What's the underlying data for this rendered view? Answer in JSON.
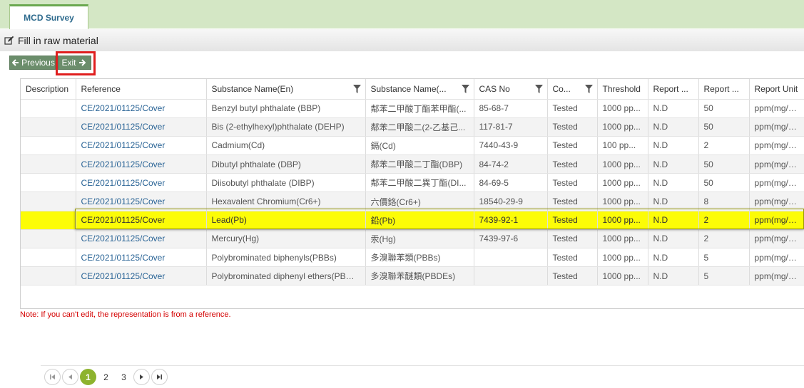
{
  "tabs": [
    {
      "label": "MCD Survey"
    }
  ],
  "section": {
    "title": "Fill in raw material"
  },
  "toolbar": {
    "previous_label": "Previous",
    "exit_label": "Exit"
  },
  "table": {
    "columns": [
      "Description",
      "Reference",
      "Substance Name(En)",
      "Substance Name(...",
      "CAS No",
      "Co...",
      "Threshold",
      "Report ...",
      "Report ...",
      "Report Unit"
    ],
    "rows": [
      [
        "",
        "CE/2021/01125/Cover",
        "Benzyl butyl phthalate (BBP)",
        "鄰苯二甲酸丁酯苯甲酯(...",
        "85-68-7",
        "Tested",
        "1000 pp...",
        "N.D",
        "50",
        "ppm(mg/kg)"
      ],
      [
        "",
        "CE/2021/01125/Cover",
        "Bis (2-ethylhexyl)phthalate (DEHP)",
        "鄰苯二甲酸二(2-乙基己...",
        "117-81-7",
        "Tested",
        "1000 pp...",
        "N.D",
        "50",
        "ppm(mg/kg)"
      ],
      [
        "",
        "CE/2021/01125/Cover",
        "Cadmium(Cd)",
        "鎘(Cd)",
        "7440-43-9",
        "Tested",
        "100 pp...",
        "N.D",
        "2",
        "ppm(mg/kg)"
      ],
      [
        "",
        "CE/2021/01125/Cover",
        "Dibutyl phthalate (DBP)",
        "鄰苯二甲酸二丁酯(DBP)",
        "84-74-2",
        "Tested",
        "1000 pp...",
        "N.D",
        "50",
        "ppm(mg/kg)"
      ],
      [
        "",
        "CE/2021/01125/Cover",
        "Diisobutyl phthalate (DIBP)",
        "鄰苯二甲酸二異丁酯(DI...",
        "84-69-5",
        "Tested",
        "1000 pp...",
        "N.D",
        "50",
        "ppm(mg/kg)"
      ],
      [
        "",
        "CE/2021/01125/Cover",
        "Hexavalent Chromium(Cr6+)",
        "六價鉻(Cr6+)",
        "18540-29-9",
        "Tested",
        "1000 pp...",
        "N.D",
        "8",
        "ppm(mg/kg)"
      ],
      [
        "",
        "CE/2021/01125/Cover",
        "Lead(Pb)",
        "鉛(Pb)",
        "7439-92-1",
        "Tested",
        "1000 pp...",
        "N.D",
        "2",
        "ppm(mg/kg)"
      ],
      [
        "",
        "CE/2021/01125/Cover",
        "Mercury(Hg)",
        "汞(Hg)",
        "7439-97-6",
        "Tested",
        "1000 pp...",
        "N.D",
        "2",
        "ppm(mg/kg)"
      ],
      [
        "",
        "CE/2021/01125/Cover",
        "Polybrominated biphenyls(PBBs)",
        "多溴聯苯類(PBBs)",
        "",
        "Tested",
        "1000 pp...",
        "N.D",
        "5",
        "ppm(mg/kg)"
      ],
      [
        "",
        "CE/2021/01125/Cover",
        "Polybrominated diphenyl ethers(PBDEs)",
        "多溴聯苯醚類(PBDEs)",
        "",
        "Tested",
        "1000 pp...",
        "N.D",
        "5",
        "ppm(mg/kg)"
      ]
    ]
  },
  "pager": {
    "pages": [
      "1",
      "2",
      "3"
    ],
    "current": "1"
  },
  "note": "Note: If you can't edit, the representation is from a reference.",
  "colors": {
    "accent": "#8db32e",
    "button": "#6b8d6b",
    "highlight": "#fcfc07",
    "alert": "#e01e1e"
  }
}
